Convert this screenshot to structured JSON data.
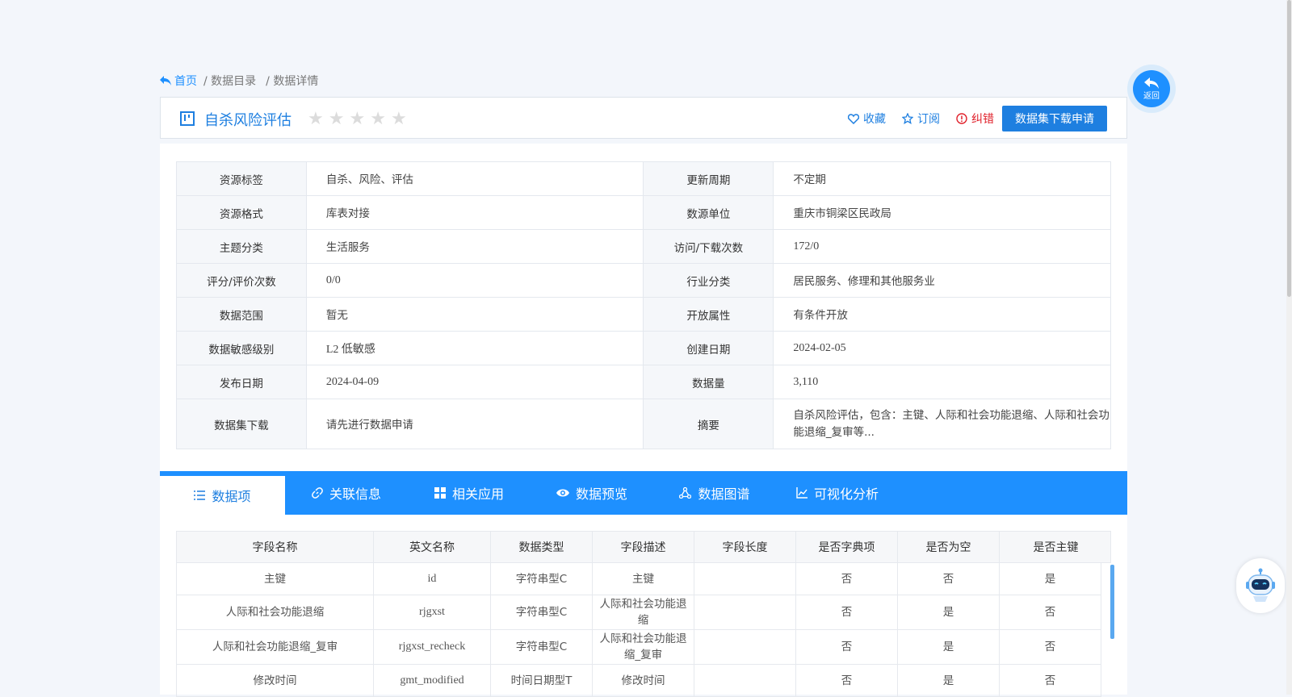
{
  "breadcrumb": {
    "home": "首页",
    "catalog": "/ 数据目录",
    "detail": "/ 数据详情"
  },
  "header": {
    "title": "自杀风险评估",
    "rating": 0,
    "favorite": "收藏",
    "subscribe": "订阅",
    "correct": "纠错",
    "apply": "数据集下载申请"
  },
  "info": {
    "rows": [
      {
        "l1": "资源标签",
        "v1": "自杀、风险、评估",
        "l2": "更新周期",
        "v2": "不定期"
      },
      {
        "l1": "资源格式",
        "v1": "库表对接",
        "l2": "数源单位",
        "v2": "重庆市铜梁区民政局"
      },
      {
        "l1": "主题分类",
        "v1": "生活服务",
        "l2": "访问/下载次数",
        "v2": "172/0"
      },
      {
        "l1": "评分/评价次数",
        "v1": "0/0",
        "l2": "行业分类",
        "v2": "居民服务、修理和其他服务业"
      },
      {
        "l1": "数据范围",
        "v1": "暂无",
        "l2": "开放属性",
        "v2": "有条件开放"
      },
      {
        "l1": "数据敏感级别",
        "v1": "L2 低敏感",
        "l2": "创建日期",
        "v2": "2024-02-05"
      },
      {
        "l1": "发布日期",
        "v1": "2024-04-09",
        "l2": "数据量",
        "v2": "3,110"
      },
      {
        "l1": "数据集下载",
        "v1": "请先进行数据申请",
        "l2": "摘要",
        "v2": "自杀风险评估，包含：主键、人际和社会功能退缩、人际和社会功能退缩_复审等..."
      }
    ]
  },
  "tabs": [
    "数据项",
    "关联信息",
    "相关应用",
    "数据预览",
    "数据图谱",
    "可视化分析"
  ],
  "fields": {
    "headers": [
      "字段名称",
      "英文名称",
      "数据类型",
      "字段描述",
      "字段长度",
      "是否字典项",
      "是否为空",
      "是否主键"
    ],
    "rows": [
      [
        "主键",
        "id",
        "字符串型C",
        "主键",
        "",
        "否",
        "否",
        "是"
      ],
      [
        "人际和社会功能退缩",
        "rjgxst",
        "字符串型C",
        "人际和社会功能退缩",
        "",
        "否",
        "是",
        "否"
      ],
      [
        "人际和社会功能退缩_复审",
        "rjgxst_recheck",
        "字符串型C",
        "人际和社会功能退缩_复审",
        "",
        "否",
        "是",
        "否"
      ],
      [
        "修改时间",
        "gmt_modified",
        "时间日期型T",
        "修改时间",
        "",
        "否",
        "是",
        "否"
      ]
    ]
  },
  "back": "返回"
}
